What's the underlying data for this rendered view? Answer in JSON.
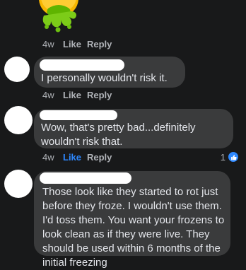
{
  "comments": [
    {
      "time": "4w",
      "like_label": "Like",
      "reply_label": "Reply"
    },
    {
      "text": "I personally wouldn't risk it.",
      "time": "4w",
      "like_label": "Like",
      "reply_label": "Reply"
    },
    {
      "text": "Wow, that's pretty bad...definitely wouldn't risk that.",
      "time": "4w",
      "like_label": "Like",
      "liked": true,
      "reply_label": "Reply",
      "reaction_count": "1"
    },
    {
      "text": "Those look like they started to rot just before they froze. I wouldn't use them. I'd toss them. You want your frozens to look clean as if they were live. They should be used within 6 months of the initial freezing"
    }
  ],
  "icons": {
    "emoji": "nauseated-face-icon",
    "reaction": "thumbs-up-icon"
  },
  "colors": {
    "background": "#18191a",
    "bubble": "#3a3b3c",
    "text": "#e4e6eb",
    "meta": "#b0b3b8",
    "liked": "#2d88ff"
  }
}
